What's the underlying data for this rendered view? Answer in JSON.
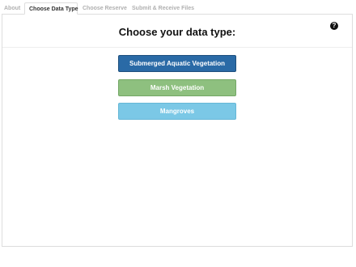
{
  "tabs": [
    {
      "label": "About"
    },
    {
      "label": "Choose Data Type",
      "active": true
    },
    {
      "label": "Choose Reserve"
    },
    {
      "label": "Submit & Receive Files"
    }
  ],
  "main": {
    "title": "Choose your data type:",
    "help_icon": "?",
    "buttons": [
      {
        "label": "Submerged Aquatic Vegetation",
        "color": "#2a6aa6"
      },
      {
        "label": "Marsh Vegetation",
        "color": "#8ec07f"
      },
      {
        "label": "Mangroves",
        "color": "#7bc8e6"
      }
    ]
  }
}
